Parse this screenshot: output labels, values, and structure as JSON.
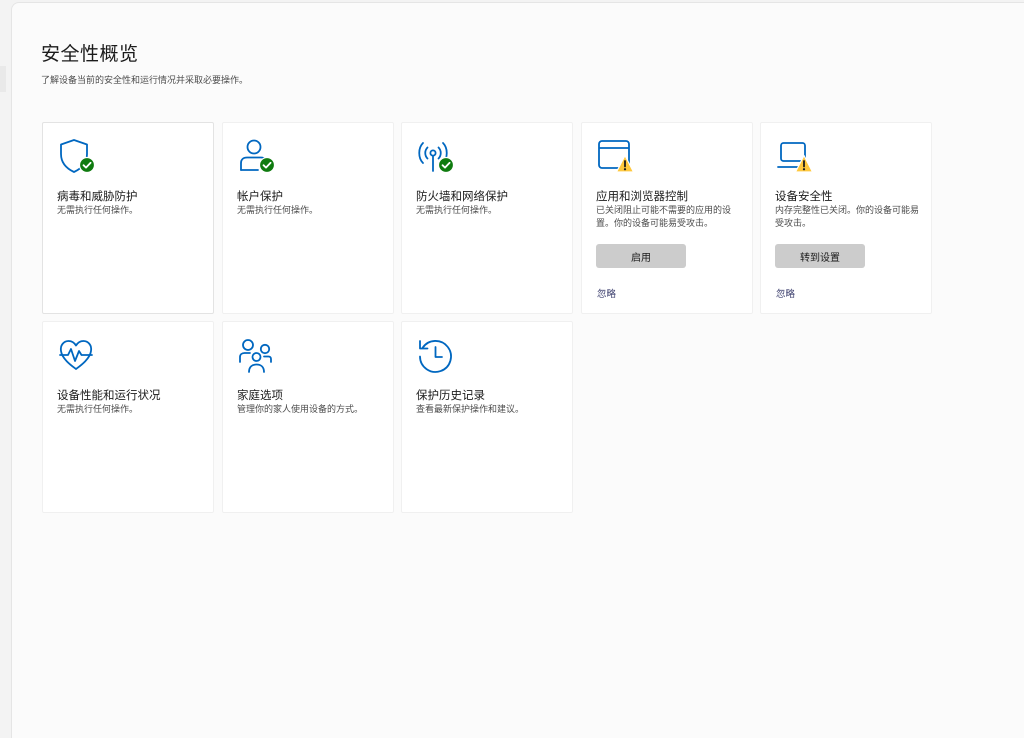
{
  "header": {
    "title": "安全性概览",
    "subtitle": "了解设备当前的安全性和运行情况并采取必要操作。"
  },
  "colors": {
    "accent": "#0067c0",
    "ok": "#0f7b0f",
    "warning": "#ffc83d",
    "button_bg": "#cccccc",
    "link": "#3c3f6e"
  },
  "cards": [
    {
      "title": "病毒和威胁防护",
      "desc": "无需执行任何操作。",
      "icon": "shield-icon",
      "status": "ok"
    },
    {
      "title": "帐户保护",
      "desc": "无需执行任何操作。",
      "icon": "account-icon",
      "status": "ok"
    },
    {
      "title": "防火墙和网络保护",
      "desc": "无需执行任何操作。",
      "icon": "wireless-antenna-icon",
      "status": "ok"
    },
    {
      "title": "应用和浏览器控制",
      "desc": "已关闭阻止可能不需要的应用的设置。你的设备可能易受攻击。",
      "icon": "app-window-icon",
      "status": "warning",
      "button": "启用",
      "link": "忽略"
    },
    {
      "title": "设备安全性",
      "desc": "内存完整性已关闭。你的设备可能易受攻击。",
      "icon": "laptop-icon",
      "status": "warning",
      "button": "转到设置",
      "link": "忽略"
    },
    {
      "title": "设备性能和运行状况",
      "desc": "无需执行任何操作。",
      "icon": "heart-pulse-icon"
    },
    {
      "title": "家庭选项",
      "desc": "管理你的家人使用设备的方式。",
      "icon": "family-icon"
    },
    {
      "title": "保护历史记录",
      "desc": "查看最新保护操作和建议。",
      "icon": "history-clock-icon"
    }
  ]
}
